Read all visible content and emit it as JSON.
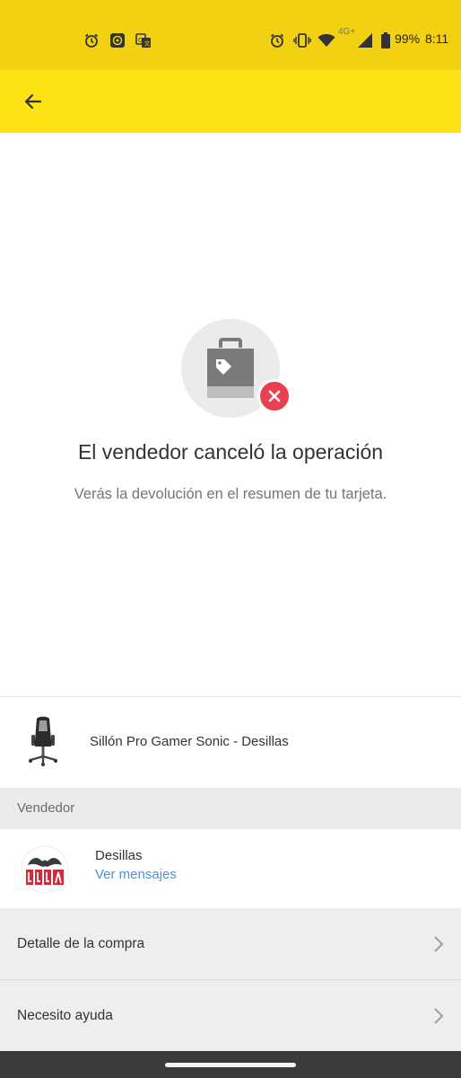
{
  "status_bar": {
    "battery": "99%",
    "time": "8:11",
    "network": "4G+",
    "left_icons": [
      "alarm-icon",
      "app-icon",
      "translate-icon"
    ],
    "right_icons": [
      "alarm-icon",
      "vibrate-icon",
      "wifi-icon",
      "signal-icon",
      "battery-icon"
    ]
  },
  "app_bar": {
    "back_icon": "arrow-left-icon",
    "color": "#fde216"
  },
  "status_message": {
    "title": "El vendedor canceló la operación",
    "subtitle": "Verás la devolución en el resumen de tu tarjeta.",
    "icon": "shopping-bag-icon",
    "badge_icon": "close-icon",
    "badge_color": "#e8404f"
  },
  "product": {
    "name": "Sillón Pro Gamer Sonic - Desillas",
    "thumbnail_icon": "gaming-chair-icon"
  },
  "seller_section": {
    "header": "Vendedor",
    "seller_name": "Desillas",
    "messages_link": "Ver mensajes",
    "link_color": "#4a90e2"
  },
  "menu": {
    "items": [
      {
        "label": "Detalle de la compra",
        "icon": "chevron-right-icon"
      },
      {
        "label": "Necesito ayuda",
        "icon": "chevron-right-icon"
      }
    ]
  }
}
